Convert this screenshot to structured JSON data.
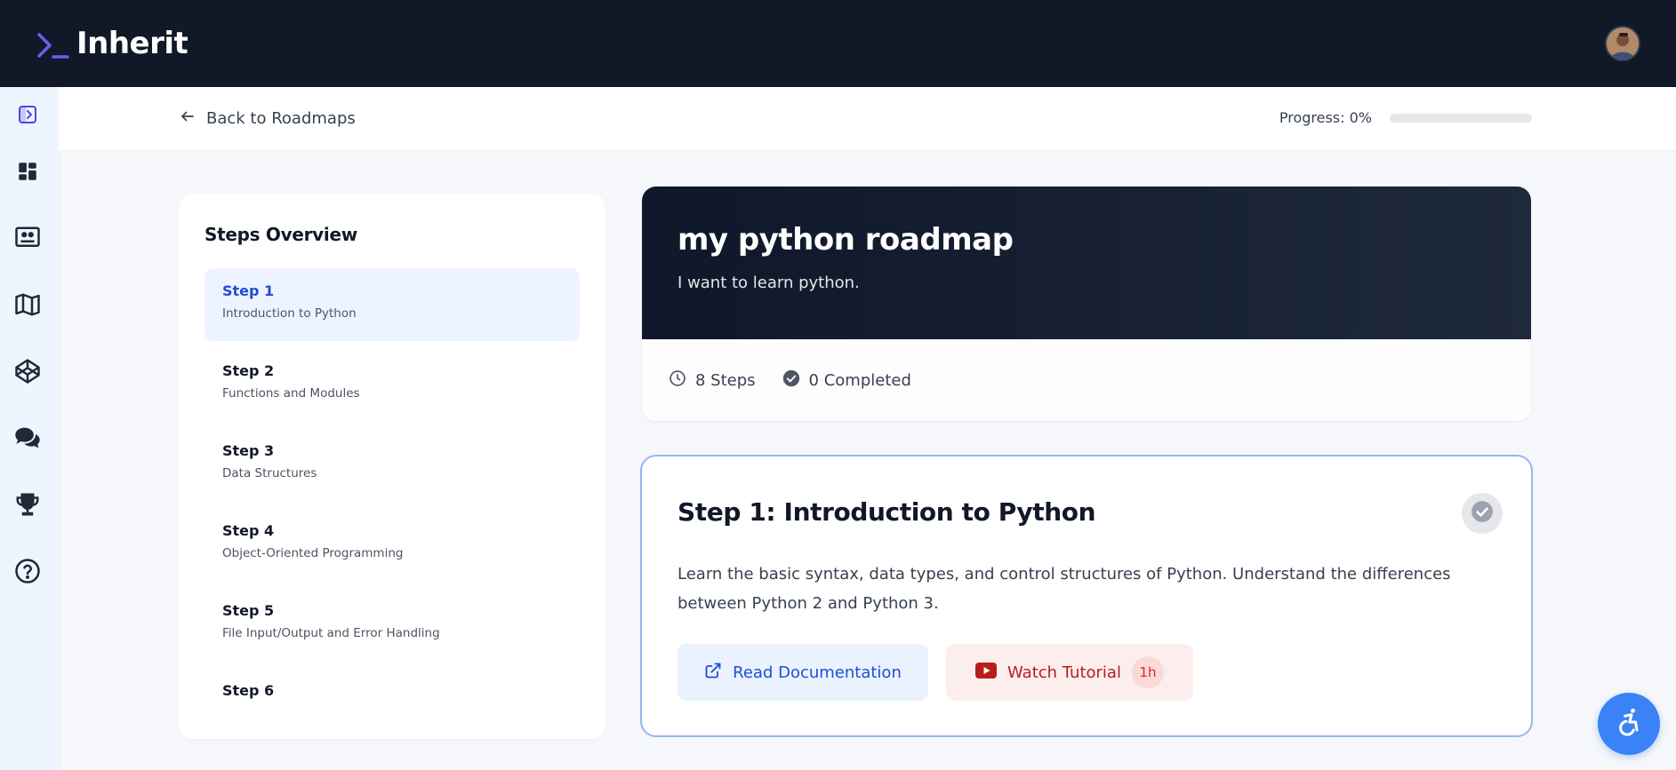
{
  "app": {
    "brand_name": "Inherit"
  },
  "subheader": {
    "back_label": "Back to Roadmaps",
    "progress_label": "Progress: 0%",
    "progress_value": 0
  },
  "steps_overview": {
    "title": "Steps Overview",
    "items": [
      {
        "num": "Step 1",
        "name": "Introduction to Python",
        "active": true
      },
      {
        "num": "Step 2",
        "name": "Functions and Modules",
        "active": false
      },
      {
        "num": "Step 3",
        "name": "Data Structures",
        "active": false
      },
      {
        "num": "Step 4",
        "name": "Object-Oriented Programming",
        "active": false
      },
      {
        "num": "Step 5",
        "name": "File Input/Output and Error Handling",
        "active": false
      },
      {
        "num": "Step 6",
        "name": "",
        "active": false
      }
    ]
  },
  "roadmap": {
    "title": "my python roadmap",
    "description": "I want to learn python.",
    "steps_count": "8 Steps",
    "completed_count": "0 Completed"
  },
  "current_step": {
    "title": "Step 1: Introduction to Python",
    "description": "Learn the basic syntax, data types, and control structures of Python. Understand the differences between Python 2 and Python 3.",
    "doc_button": "Read Documentation",
    "tutorial_button": "Watch Tutorial",
    "tutorial_duration": "1h"
  },
  "sidebar": {
    "items": [
      {
        "icon": "sidebar-toggle-icon"
      },
      {
        "icon": "dashboard-icon"
      },
      {
        "icon": "presentation-icon"
      },
      {
        "icon": "map-icon"
      },
      {
        "icon": "codepen-icon"
      },
      {
        "icon": "chat-icon"
      },
      {
        "icon": "trophy-icon"
      },
      {
        "icon": "help-icon"
      }
    ]
  },
  "colors": {
    "topbar": "#111827",
    "accent": "#4f46e5",
    "active_step": "#1d4ed8",
    "youtube_red": "#dc2626",
    "a11y_button": "#3b82f6"
  }
}
